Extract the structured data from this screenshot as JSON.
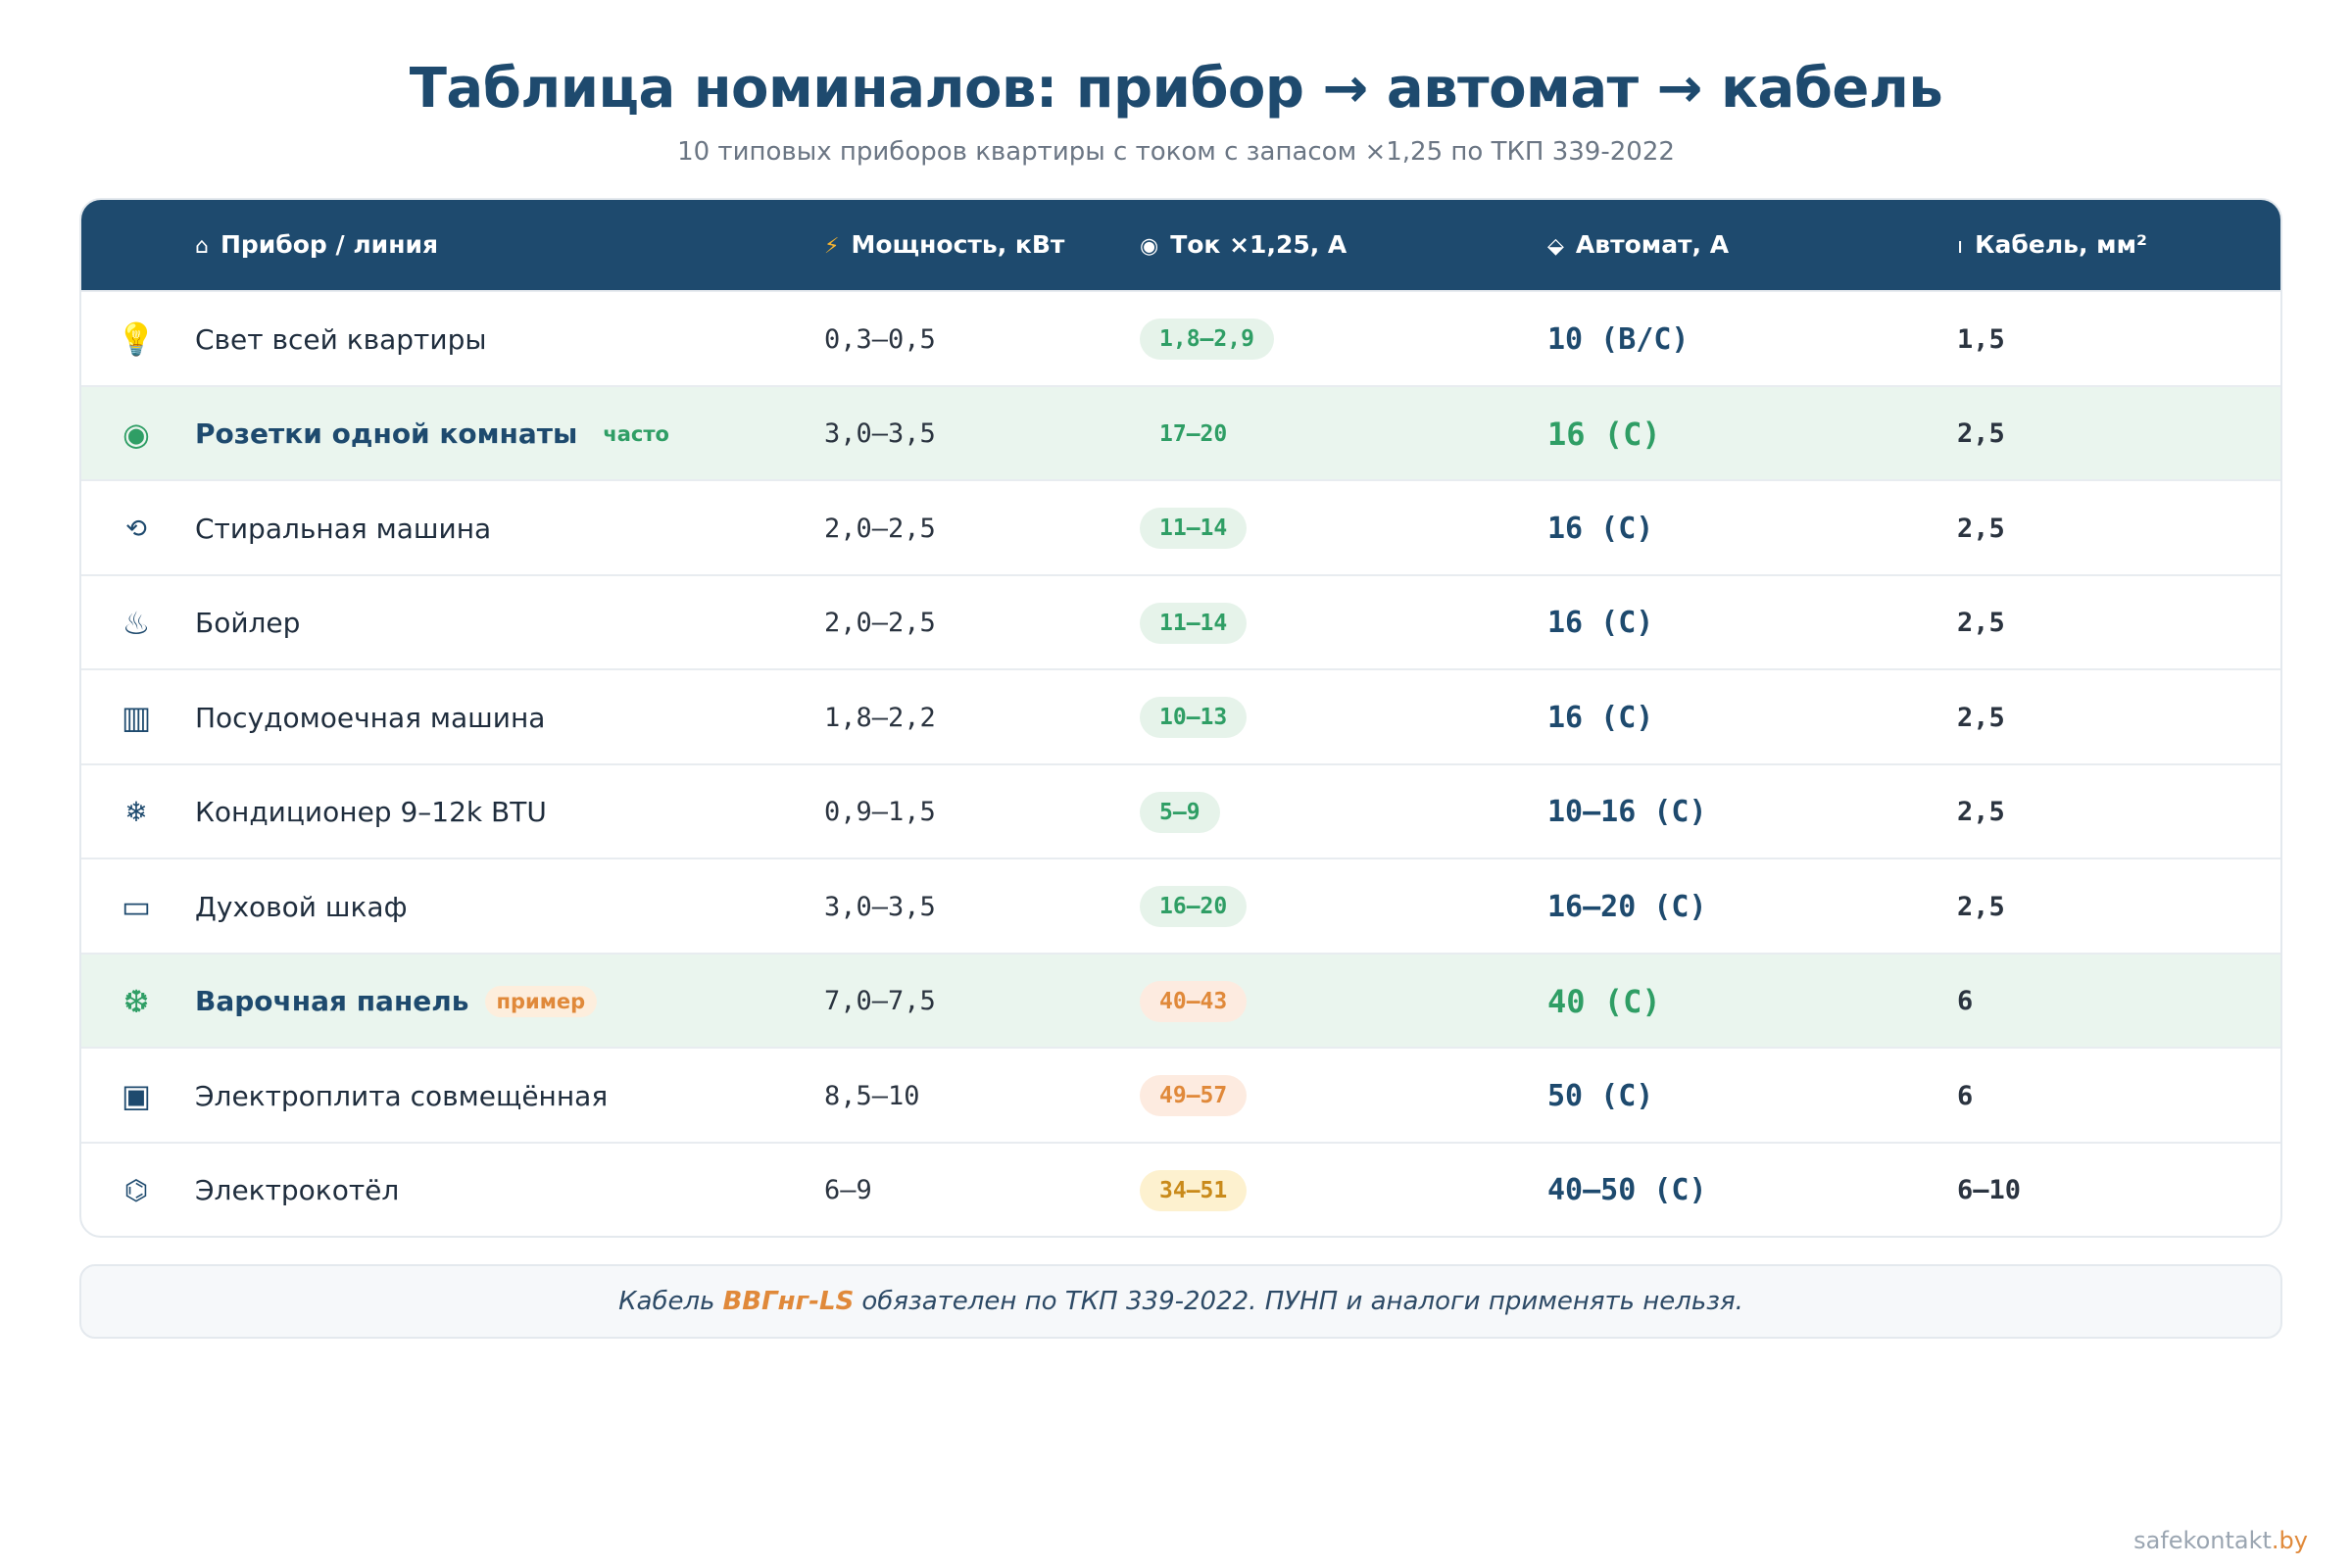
{
  "header": {
    "title": "Таблица номиналов: прибор → автомат → кабель",
    "subtitle": "10 типовых приборов квартиры с током с запасом ×1,25 по ТКП 339-2022"
  },
  "table": {
    "columns": [
      {
        "icon": "⌂",
        "label": "Прибор / линия"
      },
      {
        "icon": "⚡",
        "label": "Мощность, кВт"
      },
      {
        "icon": "◉",
        "label": "Ток ×1,25, А"
      },
      {
        "icon": "⬙",
        "label": "Автомат, А"
      },
      {
        "icon": "ı",
        "label": "Кабель, мм²"
      }
    ],
    "rows": [
      {
        "icon": "💡",
        "name": "Свет всей квартиры",
        "tag": "",
        "power": "0,3–0,5",
        "current": "1,8–2,9",
        "breaker": "10 (B/C)",
        "cable": "1,5"
      },
      {
        "icon": "◉",
        "name": "Розетки одной комнаты",
        "tag": "часто",
        "power": "3,0–3,5",
        "current": "17–20",
        "breaker": "16 (C)",
        "cable": "2,5"
      },
      {
        "icon": "⟲",
        "name": "Стиральная машина",
        "tag": "",
        "power": "2,0–2,5",
        "current": "11–14",
        "breaker": "16 (C)",
        "cable": "2,5"
      },
      {
        "icon": "♨",
        "name": "Бойлер",
        "tag": "",
        "power": "2,0–2,5",
        "current": "11–14",
        "breaker": "16 (C)",
        "cable": "2,5"
      },
      {
        "icon": "▥",
        "name": "Посудомоечная машина",
        "tag": "",
        "power": "1,8–2,2",
        "current": "10–13",
        "breaker": "16 (C)",
        "cable": "2,5"
      },
      {
        "icon": "❄",
        "name": "Кондиционер 9–12k BTU",
        "tag": "",
        "power": "0,9–1,5",
        "current": "5–9",
        "breaker": "10–16 (C)",
        "cable": "2,5"
      },
      {
        "icon": "▭",
        "name": "Духовой шкаф",
        "tag": "",
        "power": "3,0–3,5",
        "current": "16–20",
        "breaker": "16–20 (C)",
        "cable": "2,5"
      },
      {
        "icon": "❆",
        "name": "Варочная панель",
        "tag": "пример",
        "power": "7,0–7,5",
        "current": "40–43",
        "breaker": "40 (C)",
        "cable": "6"
      },
      {
        "icon": "▣",
        "name": "Электроплита совмещённая",
        "tag": "",
        "power": "8,5–10",
        "current": "49–57",
        "breaker": "50 (C)",
        "cable": "6"
      },
      {
        "icon": "⌬",
        "name": "Электрокотёл",
        "tag": "",
        "power": "6–9",
        "current": "34–51",
        "breaker": "40–50 (C)",
        "cable": "6–10"
      }
    ]
  },
  "note": {
    "prefix": "Кабель",
    "brand": "ВВГнг-LS",
    "suffix": "обязателен по ТКП 339-2022. ПУНП и аналоги применять нельзя."
  },
  "footer": {
    "site": "safekontakt",
    "tld": ".by"
  },
  "colors": {
    "header_bg": "#1e4a6e",
    "accent_green": "#2f9e65",
    "accent_orange": "#e0893a",
    "highlight_row": "#eaf5ee"
  }
}
